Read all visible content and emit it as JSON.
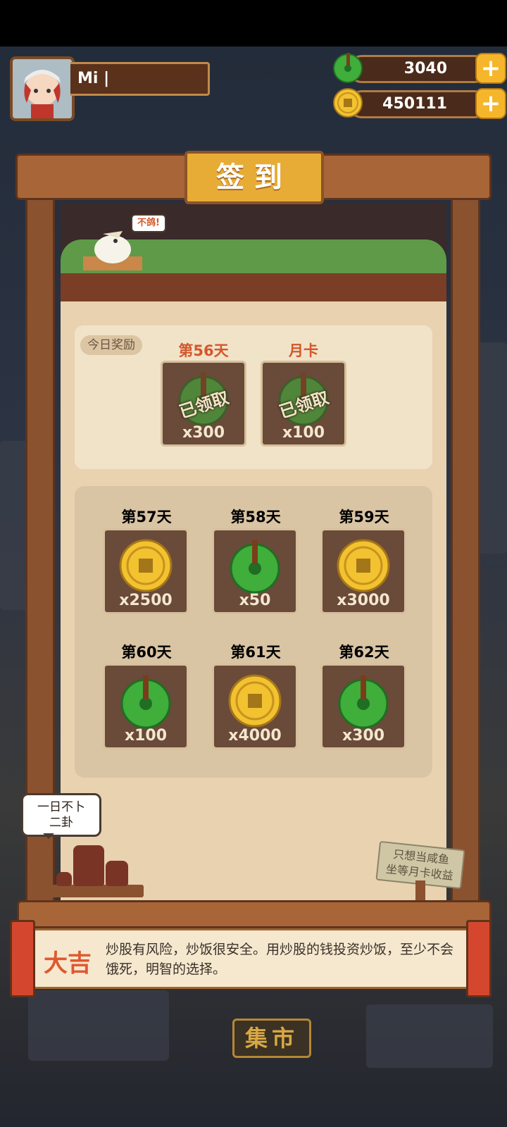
{
  "player": {
    "name": "Mi |"
  },
  "currencies": {
    "jade": {
      "value": "3040",
      "icon": "jade-coin-icon"
    },
    "gold": {
      "value": "450111",
      "icon": "gold-coin-icon"
    }
  },
  "title": "签到",
  "speech": {
    "bird": "不鸽!",
    "shop": "一日不卜\n二卦",
    "sign": "只想当咸鱼\n坐等月卡收益"
  },
  "today": {
    "tag": "今日奖励",
    "rewards": [
      {
        "label": "第56天",
        "amount": "x300",
        "status": "已领取",
        "icon": "jade-coin-icon"
      },
      {
        "label": "月卡",
        "amount": "x100",
        "status": "已领取",
        "icon": "jade-coin-icon"
      }
    ]
  },
  "upcoming": [
    {
      "label": "第57天",
      "amount": "x2500",
      "icon": "gold-coin-icon"
    },
    {
      "label": "第58天",
      "amount": "x50",
      "icon": "jade-coin-icon"
    },
    {
      "label": "第59天",
      "amount": "x3000",
      "icon": "gold-coin-icon"
    },
    {
      "label": "第60天",
      "amount": "x100",
      "icon": "jade-coin-icon"
    },
    {
      "label": "第61天",
      "amount": "x4000",
      "icon": "gold-coin-icon"
    },
    {
      "label": "第62天",
      "amount": "x300",
      "icon": "jade-coin-icon"
    }
  ],
  "fortune": {
    "title": "大吉",
    "text": "炒股有风险，炒饭很安全。用炒股的钱投资炒饭，至少不会饿死，明智的选择。"
  },
  "market": "集市",
  "colors": {
    "jade": "#3fae3a",
    "gold": "#f2c230",
    "accent": "#d3572a"
  }
}
